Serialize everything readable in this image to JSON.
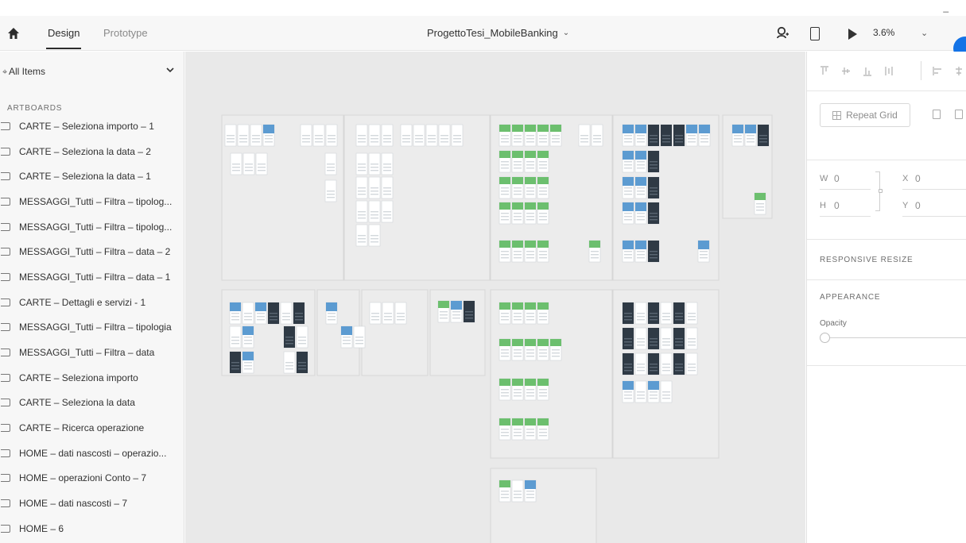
{
  "window": {
    "minimize_glyph": "_"
  },
  "header": {
    "tabs": [
      {
        "label": "Design"
      },
      {
        "label": "Prototype"
      }
    ],
    "document_title": "ProgettoTesi_MobileBanking",
    "zoom": "3.6%",
    "accent_color": "#1473e6"
  },
  "layers": {
    "search_label": "All Items",
    "section_title": "ARTBOARDS",
    "artboards": [
      "CARTE – Seleziona importo – 1",
      "CARTE – Seleziona la data – 2",
      "CARTE – Seleziona la data – 1",
      "MESSAGGI_Tutti – Filtra – tipolog...",
      "MESSAGGI_Tutti – Filtra – tipolog...",
      "MESSAGGI_Tutti – Filtra – data – 2",
      "MESSAGGI_Tutti – Filtra – data – 1",
      "CARTE – Dettagli e servizi - 1",
      "MESSAGGI_Tutti – Filtra – tipologia",
      "MESSAGGI_Tutti – Filtra – data",
      "CARTE – Seleziona importo",
      "CARTE – Seleziona la data",
      "CARTE – Ricerca operazione",
      "HOME – dati nascosti – operazio...",
      "HOME – operazioni Conto – 7",
      "HOME – dati nascosti – 7",
      "HOME – 6"
    ]
  },
  "inspector": {
    "repeat_grid_label": "Repeat Grid",
    "w_label": "W",
    "w_value": "0",
    "x_label": "X",
    "x_value": "0",
    "h_label": "H",
    "h_value": "0",
    "y_label": "Y",
    "y_value": "0",
    "responsive_title": "RESPONSIVE RESIZE",
    "appearance_title": "APPEARANCE",
    "opacity_label": "Opacity"
  }
}
